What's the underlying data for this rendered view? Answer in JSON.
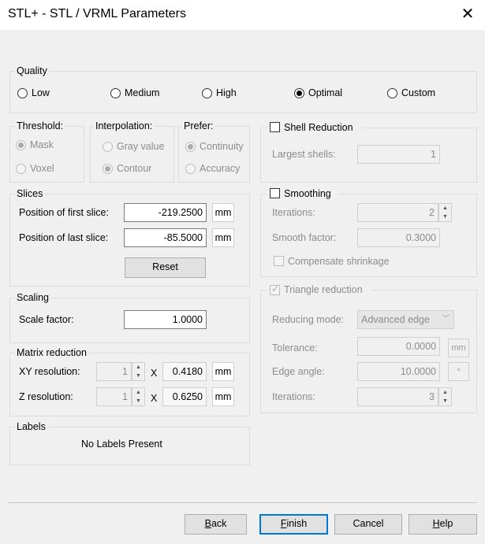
{
  "window": {
    "title": "STL+ - STL / VRML Parameters",
    "close_glyph": "✕"
  },
  "quality": {
    "label": "Quality",
    "options": [
      "Low",
      "Medium",
      "High",
      "Optimal",
      "Custom"
    ],
    "selected": "Optimal"
  },
  "threshold": {
    "label": "Threshold:",
    "options": [
      "Mask",
      "Voxel"
    ],
    "selected": "Mask"
  },
  "interpolation": {
    "label": "Interpolation:",
    "options": [
      "Gray value",
      "Contour"
    ],
    "selected": "Contour"
  },
  "prefer": {
    "label": "Prefer:",
    "options": [
      "Continuity",
      "Accuracy"
    ],
    "selected": "Continuity"
  },
  "slices": {
    "label": "Slices",
    "first_label": "Position of first slice:",
    "first_value": "-219.2500",
    "first_unit": "mm",
    "last_label": "Position of last slice:",
    "last_value": "-85.5000",
    "last_unit": "mm",
    "reset_label": "Reset"
  },
  "scaling": {
    "label": "Scaling",
    "factor_label": "Scale factor:",
    "factor_value": "1.0000"
  },
  "matrix": {
    "label": "Matrix reduction",
    "xy_label": "XY resolution:",
    "xy_count": "1",
    "xy_x": "X",
    "xy_value": "0.4180",
    "xy_unit": "mm",
    "z_label": "Z resolution:",
    "z_count": "1",
    "z_x": "X",
    "z_value": "0.6250",
    "z_unit": "mm"
  },
  "labels": {
    "label": "Labels",
    "text": "No Labels Present"
  },
  "shell": {
    "label": "Shell Reduction",
    "checked": false,
    "largest_label": "Largest shells:",
    "largest_value": "1"
  },
  "smoothing": {
    "label": "Smoothing",
    "checked": false,
    "iterations_label": "Iterations:",
    "iterations_value": "2",
    "factor_label": "Smooth factor:",
    "factor_value": "0.3000",
    "compensate_label": "Compensate shrinkage",
    "compensate_checked": false
  },
  "triangle": {
    "label": "Triangle reduction",
    "checked": true,
    "mode_label": "Reducing mode:",
    "mode_value": "Advanced edge",
    "tolerance_label": "Tolerance:",
    "tolerance_value": "0.0000",
    "tolerance_unit": "mm",
    "angle_label": "Edge angle:",
    "angle_value": "10.0000",
    "angle_unit": "°",
    "iterations_label": "Iterations:",
    "iterations_value": "3"
  },
  "buttons": {
    "back_label": "Back",
    "back_key": "B",
    "back_rest": "ack",
    "finish_key": "F",
    "finish_rest": "inish",
    "cancel_label": "Cancel",
    "help_key": "H",
    "help_rest": "elp"
  }
}
